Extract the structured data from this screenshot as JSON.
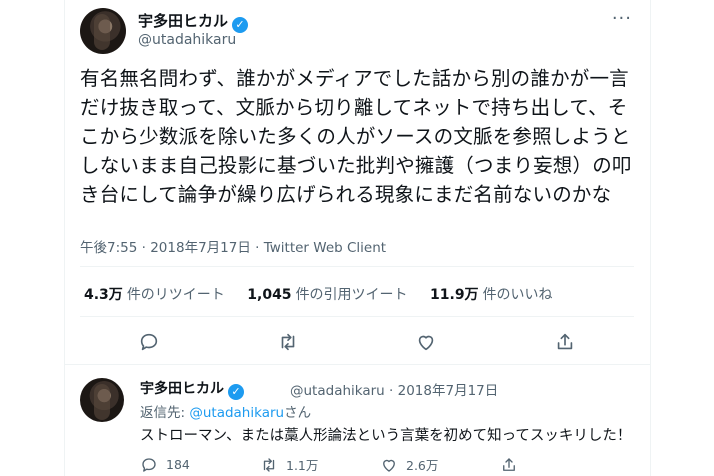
{
  "tweet": {
    "author_name": "宇多田ヒカル",
    "author_handle": "@utadahikaru",
    "more_glyph": "···",
    "text": "有名無名問わず、誰かがメディアでした話から別の誰かが一言だけ抜き取って、文脈から切り離してネットで持ち出して、そこから少数派を除いた多くの人がソースの文脈を参照しようとしないまま自己投影に基づいた批判や擁護（つまり妄想）の叩き台にして論争が繰り広げられる現象にまだ名前ないのかな",
    "time": "午後7:55",
    "date": "2018年7月17日",
    "separator": "·",
    "client": "Twitter Web Client",
    "stats": {
      "retweets_count": "4.3万",
      "retweets_label": "件のリツイート",
      "quotes_count": "1,045",
      "quotes_label": "件の引用ツイート",
      "likes_count": "11.9万",
      "likes_label": "件のいいね"
    }
  },
  "reply": {
    "author_name": "宇多田ヒカル",
    "author_handle": "@utadahikaru",
    "separator": "·",
    "date": "2018年7月17日",
    "replying_prefix": "返信先: ",
    "replying_to": "@utadahikaru",
    "replying_suffix": "さん",
    "text": "ストローマン、または藁人形論法という言葉を初めて知ってスッキリした！",
    "reply_count": "184",
    "retweet_count": "1.1万",
    "like_count": "2.6万"
  },
  "icons": [
    "verified-icon",
    "more-icon",
    "reply-icon",
    "retweet-icon",
    "like-icon",
    "share-icon"
  ],
  "colors": {
    "accent": "#1d9bf0",
    "secondary_text": "#536471",
    "text": "#0f1419",
    "border": "#eff3f4"
  }
}
